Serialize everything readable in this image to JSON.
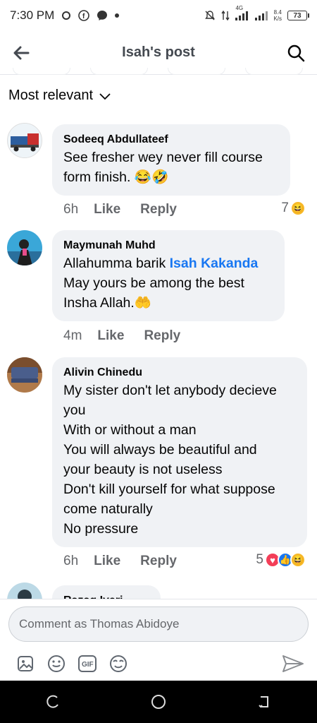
{
  "status_bar": {
    "time": "7:30 PM",
    "network": "4G",
    "speed_value": "8.4",
    "speed_unit": "K/s",
    "battery": "73"
  },
  "header": {
    "title": "Isah's post"
  },
  "sort": {
    "label": "Most relevant"
  },
  "comments": [
    {
      "name": "Sodeeq Abdullateef",
      "lines": [
        "See fresher wey never fill course",
        "form finish. 😂🤣"
      ],
      "time": "6h",
      "like": "Like",
      "reply": "Reply",
      "reaction_count": "7",
      "reactions": [
        "haha"
      ]
    },
    {
      "name": "Maymunah Muhd",
      "line1_prefix": "Allahumma barik ",
      "mention": "Isah Kakanda",
      "lines": [
        "May yours be among the best",
        "Insha Allah.🤲"
      ],
      "time": "4m",
      "like": "Like",
      "reply": "Reply"
    },
    {
      "name": "Alivin Chinedu",
      "lines": [
        "My sister don't let anybody decieve",
        "you",
        "With or without a man",
        "You will always be beautiful and",
        "your beauty is not useless",
        "Don't kill yourself for what suppose",
        "come naturally",
        "No pressure"
      ],
      "time": "6h",
      "like": "Like",
      "reply": "Reply",
      "reaction_count": "5",
      "reactions": [
        "love",
        "like",
        "haha"
      ]
    },
    {
      "name": "Razaq Iyeri"
    }
  ],
  "composer": {
    "placeholder": "Comment as Thomas Abidoye"
  },
  "colors": {
    "link_blue": "#1877f2",
    "bubble_bg": "#f0f2f5",
    "secondary_text": "#65676b"
  }
}
